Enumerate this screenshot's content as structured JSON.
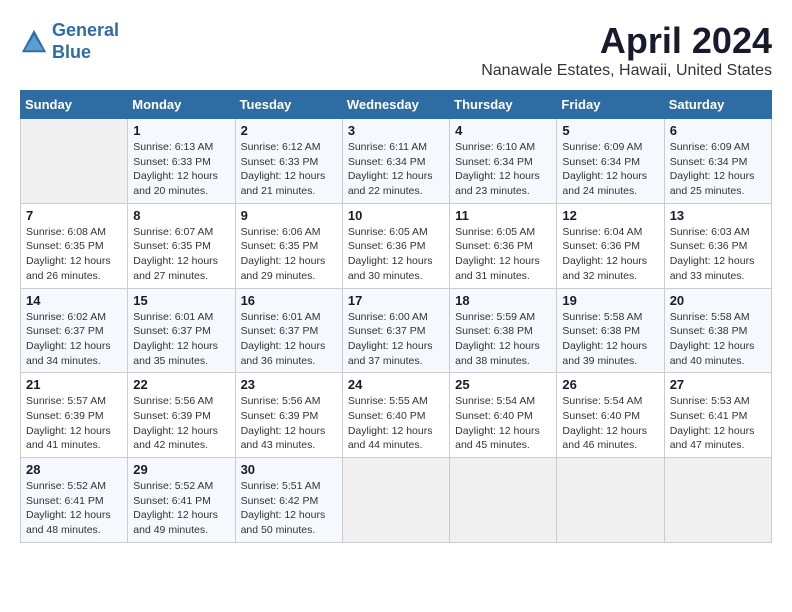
{
  "logo": {
    "line1": "General",
    "line2": "Blue"
  },
  "title": "April 2024",
  "subtitle": "Nanawale Estates, Hawaii, United States",
  "headers": [
    "Sunday",
    "Monday",
    "Tuesday",
    "Wednesday",
    "Thursday",
    "Friday",
    "Saturday"
  ],
  "weeks": [
    [
      {
        "day": "",
        "info": ""
      },
      {
        "day": "1",
        "info": "Sunrise: 6:13 AM\nSunset: 6:33 PM\nDaylight: 12 hours\nand 20 minutes."
      },
      {
        "day": "2",
        "info": "Sunrise: 6:12 AM\nSunset: 6:33 PM\nDaylight: 12 hours\nand 21 minutes."
      },
      {
        "day": "3",
        "info": "Sunrise: 6:11 AM\nSunset: 6:34 PM\nDaylight: 12 hours\nand 22 minutes."
      },
      {
        "day": "4",
        "info": "Sunrise: 6:10 AM\nSunset: 6:34 PM\nDaylight: 12 hours\nand 23 minutes."
      },
      {
        "day": "5",
        "info": "Sunrise: 6:09 AM\nSunset: 6:34 PM\nDaylight: 12 hours\nand 24 minutes."
      },
      {
        "day": "6",
        "info": "Sunrise: 6:09 AM\nSunset: 6:34 PM\nDaylight: 12 hours\nand 25 minutes."
      }
    ],
    [
      {
        "day": "7",
        "info": "Sunrise: 6:08 AM\nSunset: 6:35 PM\nDaylight: 12 hours\nand 26 minutes."
      },
      {
        "day": "8",
        "info": "Sunrise: 6:07 AM\nSunset: 6:35 PM\nDaylight: 12 hours\nand 27 minutes."
      },
      {
        "day": "9",
        "info": "Sunrise: 6:06 AM\nSunset: 6:35 PM\nDaylight: 12 hours\nand 29 minutes."
      },
      {
        "day": "10",
        "info": "Sunrise: 6:05 AM\nSunset: 6:36 PM\nDaylight: 12 hours\nand 30 minutes."
      },
      {
        "day": "11",
        "info": "Sunrise: 6:05 AM\nSunset: 6:36 PM\nDaylight: 12 hours\nand 31 minutes."
      },
      {
        "day": "12",
        "info": "Sunrise: 6:04 AM\nSunset: 6:36 PM\nDaylight: 12 hours\nand 32 minutes."
      },
      {
        "day": "13",
        "info": "Sunrise: 6:03 AM\nSunset: 6:36 PM\nDaylight: 12 hours\nand 33 minutes."
      }
    ],
    [
      {
        "day": "14",
        "info": "Sunrise: 6:02 AM\nSunset: 6:37 PM\nDaylight: 12 hours\nand 34 minutes."
      },
      {
        "day": "15",
        "info": "Sunrise: 6:01 AM\nSunset: 6:37 PM\nDaylight: 12 hours\nand 35 minutes."
      },
      {
        "day": "16",
        "info": "Sunrise: 6:01 AM\nSunset: 6:37 PM\nDaylight: 12 hours\nand 36 minutes."
      },
      {
        "day": "17",
        "info": "Sunrise: 6:00 AM\nSunset: 6:37 PM\nDaylight: 12 hours\nand 37 minutes."
      },
      {
        "day": "18",
        "info": "Sunrise: 5:59 AM\nSunset: 6:38 PM\nDaylight: 12 hours\nand 38 minutes."
      },
      {
        "day": "19",
        "info": "Sunrise: 5:58 AM\nSunset: 6:38 PM\nDaylight: 12 hours\nand 39 minutes."
      },
      {
        "day": "20",
        "info": "Sunrise: 5:58 AM\nSunset: 6:38 PM\nDaylight: 12 hours\nand 40 minutes."
      }
    ],
    [
      {
        "day": "21",
        "info": "Sunrise: 5:57 AM\nSunset: 6:39 PM\nDaylight: 12 hours\nand 41 minutes."
      },
      {
        "day": "22",
        "info": "Sunrise: 5:56 AM\nSunset: 6:39 PM\nDaylight: 12 hours\nand 42 minutes."
      },
      {
        "day": "23",
        "info": "Sunrise: 5:56 AM\nSunset: 6:39 PM\nDaylight: 12 hours\nand 43 minutes."
      },
      {
        "day": "24",
        "info": "Sunrise: 5:55 AM\nSunset: 6:40 PM\nDaylight: 12 hours\nand 44 minutes."
      },
      {
        "day": "25",
        "info": "Sunrise: 5:54 AM\nSunset: 6:40 PM\nDaylight: 12 hours\nand 45 minutes."
      },
      {
        "day": "26",
        "info": "Sunrise: 5:54 AM\nSunset: 6:40 PM\nDaylight: 12 hours\nand 46 minutes."
      },
      {
        "day": "27",
        "info": "Sunrise: 5:53 AM\nSunset: 6:41 PM\nDaylight: 12 hours\nand 47 minutes."
      }
    ],
    [
      {
        "day": "28",
        "info": "Sunrise: 5:52 AM\nSunset: 6:41 PM\nDaylight: 12 hours\nand 48 minutes."
      },
      {
        "day": "29",
        "info": "Sunrise: 5:52 AM\nSunset: 6:41 PM\nDaylight: 12 hours\nand 49 minutes."
      },
      {
        "day": "30",
        "info": "Sunrise: 5:51 AM\nSunset: 6:42 PM\nDaylight: 12 hours\nand 50 minutes."
      },
      {
        "day": "",
        "info": ""
      },
      {
        "day": "",
        "info": ""
      },
      {
        "day": "",
        "info": ""
      },
      {
        "day": "",
        "info": ""
      }
    ]
  ]
}
